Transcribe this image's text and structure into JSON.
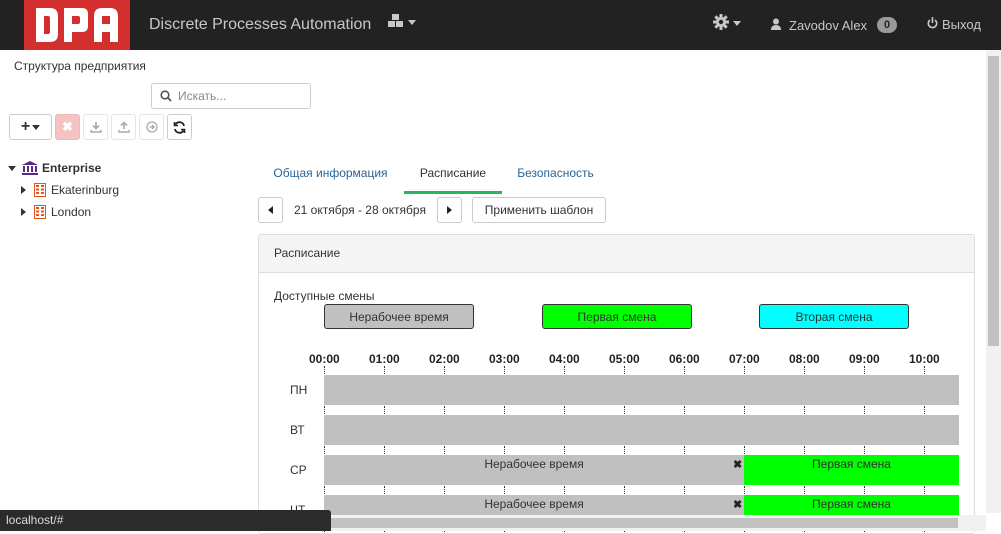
{
  "app": {
    "brand": "Discrete Processes Automation",
    "logo_text": "DPA",
    "user": "Zavodov Alex",
    "notifications_count": "0",
    "logout_label": "Выход"
  },
  "sidebar": {
    "title": "Структура предприятия",
    "search_placeholder": "Искать...",
    "tree": [
      {
        "label": "Enterprise",
        "expanded": true,
        "icon": "bank-icon"
      },
      {
        "label": "Ekaterinburg",
        "expanded": false,
        "icon": "building-icon"
      },
      {
        "label": "London",
        "expanded": false,
        "icon": "building-icon"
      }
    ]
  },
  "tabs": [
    {
      "label": "Общая информация",
      "active": false
    },
    {
      "label": "Расписание",
      "active": true
    },
    {
      "label": "Безопасность",
      "active": false
    }
  ],
  "schedule": {
    "date_range": "21 октября - 28 октября",
    "apply_template_label": "Применить шаблон",
    "panel_title": "Расписание",
    "available_shifts_label": "Доступные смены",
    "shifts": [
      {
        "label": "Нерабочее время",
        "color": "#c0c0c0"
      },
      {
        "label": "Первая смена",
        "color": "#00ff00"
      },
      {
        "label": "Вторая смена",
        "color": "#00ffff"
      }
    ],
    "hours": [
      "00:00",
      "01:00",
      "02:00",
      "03:00",
      "04:00",
      "05:00",
      "06:00",
      "07:00",
      "08:00",
      "09:00",
      "10:00"
    ],
    "days": [
      {
        "label": "ПН",
        "segments": [
          {
            "label": "",
            "color": "#c0c0c0",
            "start": 0,
            "end": 10.6
          }
        ]
      },
      {
        "label": "ВТ",
        "segments": [
          {
            "label": "",
            "color": "#c0c0c0",
            "start": 0,
            "end": 10.6
          }
        ]
      },
      {
        "label": "СР",
        "segments": [
          {
            "label": "Нерабочее время",
            "color": "#c0c0c0",
            "start": 0,
            "end": 7
          },
          {
            "label": "Первая смена",
            "color": "#00ff00",
            "start": 7,
            "end": 10.6
          }
        ]
      },
      {
        "label": "ЧТ",
        "segments": [
          {
            "label": "Нерабочее время",
            "color": "#c0c0c0",
            "start": 0,
            "end": 7
          },
          {
            "label": "Первая смена",
            "color": "#00ff00",
            "start": 7,
            "end": 10.6
          }
        ]
      }
    ]
  },
  "status_bar": {
    "url": "localhost/#"
  }
}
